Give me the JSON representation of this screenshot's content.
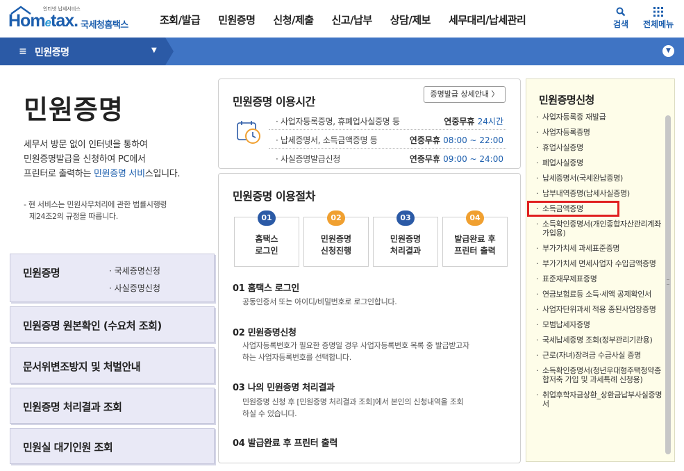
{
  "header": {
    "logo_tagline": "인터넷 납세서비스",
    "logo_text_home": "Hom",
    "logo_text_e": "e",
    "logo_text_tax": "tax.",
    "logo_kname": "국세청홈택스",
    "menu": [
      "조회/발급",
      "민원증명",
      "신청/제출",
      "신고/납부",
      "상담/제보",
      "세무대리/납세관리"
    ],
    "search_label": "검색",
    "allmenu_label": "전체메뉴"
  },
  "crumb": {
    "label": "민원증명"
  },
  "left": {
    "title": "민원증명",
    "desc_line1": "세무서 방문 없이 인터넷을 통하여",
    "desc_line2": "민원증명발급을 신청하여 PC에서",
    "desc_line3a": "프린터로 출력하는 ",
    "desc_line3b": "민원증명 서비",
    "desc_line3c": "스입니다.",
    "note_line1": "- 현 서비스는 민원사무처리에 관한 법률시행령",
    "note_line2": "제24조2의 규정을 따릅니다.",
    "box1": {
      "title": "민원증명",
      "sub1": "· 국세증명신청",
      "sub2": "· 사실증명신청"
    },
    "box2": "민원증명 원본확인 (수요처 조회)",
    "box3": "문서위변조방지 및 처벌안내",
    "box4": "민원증명 처리결과 조회",
    "box5": "민원실 대기인원 조회"
  },
  "hours": {
    "title": "민원증명 이용시간",
    "detail_button": "증명발급 상세안내 〉",
    "rows": [
      {
        "name": "· 사업자등록증명, 휴폐업사실증명 등",
        "prefix": "연중무휴 ",
        "time": "24시간"
      },
      {
        "name": "· 납세증명서, 소득금액증명 등",
        "prefix": "연중무휴 ",
        "time": "08:00 ~ 22:00"
      },
      {
        "name": "· 사실증명발급신청",
        "prefix": "연중무휴 ",
        "time": "09:00 ~ 24:00"
      }
    ]
  },
  "procedure": {
    "title": "민원증명 이용절차",
    "steps": [
      {
        "num": "01",
        "label": "홈택스\n로그인",
        "color": "#2b5aa6"
      },
      {
        "num": "02",
        "label": "민원증명\n신청진행",
        "color": "#f0a030"
      },
      {
        "num": "03",
        "label": "민원증명\n처리결과",
        "color": "#2b5aa6"
      },
      {
        "num": "04",
        "label": "발급완료 후\n프린터 출력",
        "color": "#f0a030"
      }
    ],
    "s1_title": "01 홈택스 로그인",
    "s1_desc1": "공동인증서 또는 아이디/비밀번호로 로그인합니다.",
    "s2_title": "02 민원증명신청",
    "s2_desc1": "사업자등록번호가 필요한 증명일 경우 사업자등록번호 목록 중 발급받고자",
    "s2_desc2": "하는 사업자등록번호를 선택합니다.",
    "s3_title": "03 나의 민원증명 처리결과",
    "s3_desc1": "민원증명 신청 후 [민원증명 처리결과 조회]에서 본인의 신청내역을 조회",
    "s3_desc2": "하실 수 있습니다.",
    "s4_title": "04 발급완료 후 프린터 출력"
  },
  "right": {
    "title": "민원증명신청",
    "items": [
      "사업자등록증 재발급",
      "사업자등록증명",
      "휴업사실증명",
      "폐업사실증명",
      "납세증명서(국세완납증명)",
      "납부내역증명(납세사실증명)",
      "소득금액증명",
      "소득확인증명서(개인종합자산관리계좌 가입용)",
      "부가가치세 과세표준증명",
      "부가가치세 면세사업자 수입금액증명",
      "표준재무제표증명",
      "연금보험료등 소득·세액 공제확인서",
      "사업자단위과세 적용 종된사업장증명",
      "모범납세자증명",
      "국세납세증명 조회(정부관리기관용)",
      "근로(자녀)장려금 수급사실 증명",
      "소득확인증명서(청년우대형주택청약종합저축 가입 및 과세특례 신청용)",
      "취업후학자금상환_상환금납부사실증명서"
    ],
    "highlight_index": 6
  },
  "colors": {
    "brand": "#1d5fae",
    "bar": "#3f74c4",
    "highlight": "#e02020",
    "orange": "#f0a030"
  }
}
